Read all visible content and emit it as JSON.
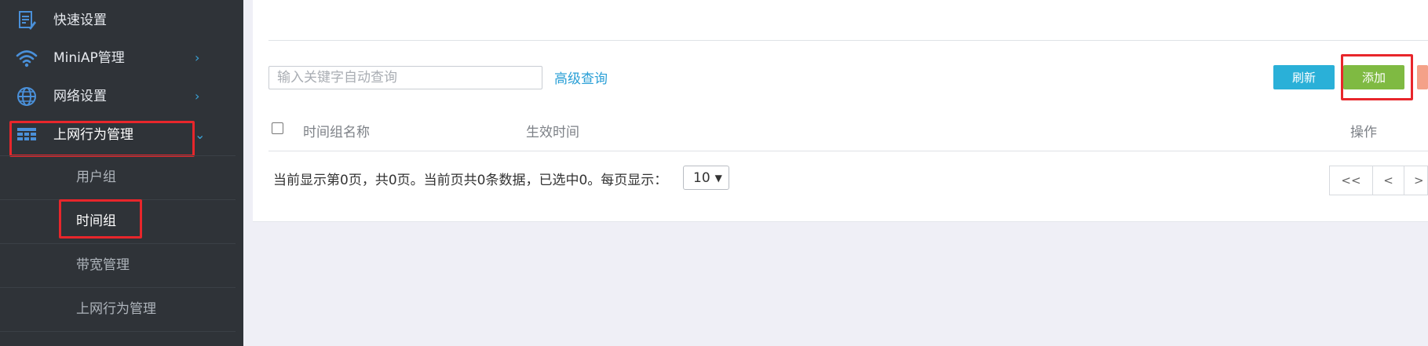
{
  "sidebar": {
    "items": [
      {
        "label": "快速设置",
        "icon": "quick-settings-icon",
        "chevron": ""
      },
      {
        "label": "MiniAP管理",
        "icon": "wifi-icon",
        "chevron": "›"
      },
      {
        "label": "网络设置",
        "icon": "globe-icon",
        "chevron": "›"
      },
      {
        "label": "上网行为管理",
        "icon": "table-icon",
        "chevron": "⌄"
      }
    ],
    "subitems": [
      {
        "label": "用户组"
      },
      {
        "label": "时间组"
      },
      {
        "label": "带宽管理"
      },
      {
        "label": "上网行为管理"
      }
    ]
  },
  "toolbar": {
    "search_placeholder": "输入关键字自动查询",
    "advanced_search": "高级查询",
    "refresh_label": "刷新",
    "add_label": "添加"
  },
  "table": {
    "columns": [
      "时间组名称",
      "生效时间",
      "操作"
    ],
    "rows": []
  },
  "pagination": {
    "summary": "当前显示第0页，共0页。当前页共0条数据，已选中0。每页显示：",
    "page_size": "10",
    "first_label": "<<",
    "prev_label": "<",
    "next_label": ">"
  },
  "colors": {
    "sidebar_bg": "#2f3338",
    "accent_blue": "#2ab0d8",
    "add_green": "#7fba42",
    "highlight_red": "#e8262b"
  }
}
